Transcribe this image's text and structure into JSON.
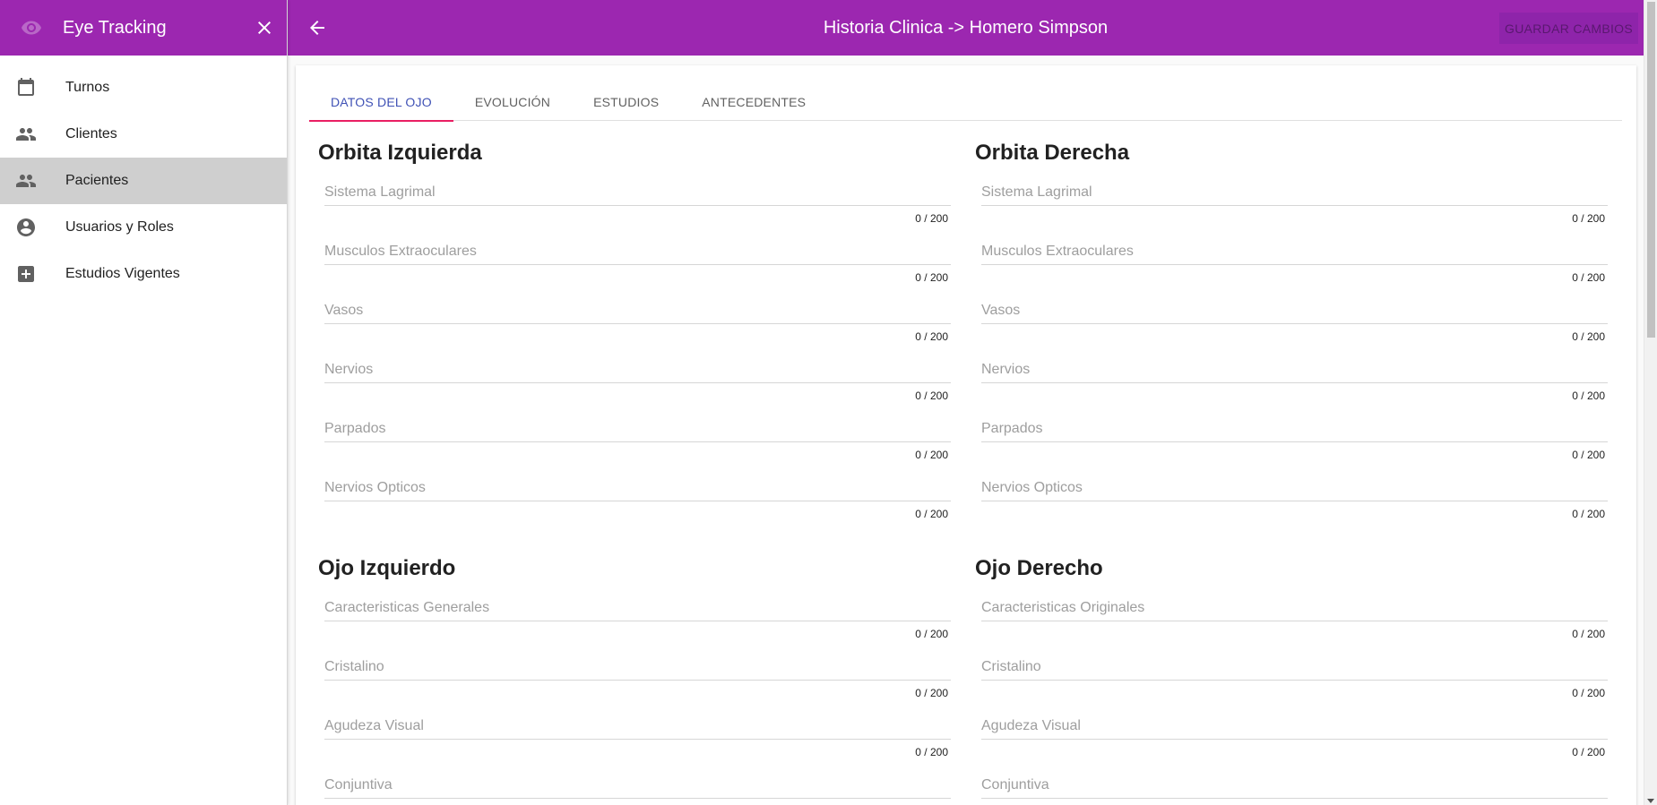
{
  "sidebar": {
    "title": "Eye Tracking",
    "items": [
      {
        "label": "Turnos",
        "icon": "calendar-icon"
      },
      {
        "label": "Clientes",
        "icon": "people-icon"
      },
      {
        "label": "Pacientes",
        "icon": "people-icon",
        "active": true
      },
      {
        "label": "Usuarios y Roles",
        "icon": "account-circle-icon"
      },
      {
        "label": "Estudios Vigentes",
        "icon": "add-box-icon"
      }
    ]
  },
  "header": {
    "title": "Historia Clinica -> Homero Simpson",
    "save_label": "GUARDAR CAMBIOS"
  },
  "tabs": [
    "DATOS DEL OJO",
    "EVOLUCIÓN",
    "ESTUDIOS",
    "ANTECEDENTES"
  ],
  "left": {
    "orbita_title": "Orbita Izquierda",
    "orbita_fields": [
      "Sistema Lagrimal",
      "Musculos Extraoculares",
      "Vasos",
      "Nervios",
      "Parpados",
      "Nervios Opticos"
    ],
    "ojo_title": "Ojo Izquierdo",
    "ojo_fields": [
      "Caracteristicas Generales",
      "Cristalino",
      "Agudeza Visual",
      "Conjuntiva"
    ]
  },
  "right": {
    "orbita_title": "Orbita Derecha",
    "orbita_fields": [
      "Sistema Lagrimal",
      "Musculos Extraoculares",
      "Vasos",
      "Nervios",
      "Parpados",
      "Nervios Opticos"
    ],
    "ojo_title": "Ojo Derecho",
    "ojo_fields": [
      "Caracteristicas Originales",
      "Cristalino",
      "Agudeza Visual",
      "Conjuntiva"
    ]
  },
  "counter": "0 / 200",
  "colors": {
    "primary": "#9c27b0",
    "tab_active": "#3f51b5",
    "tab_indicator": "#e91e63"
  }
}
